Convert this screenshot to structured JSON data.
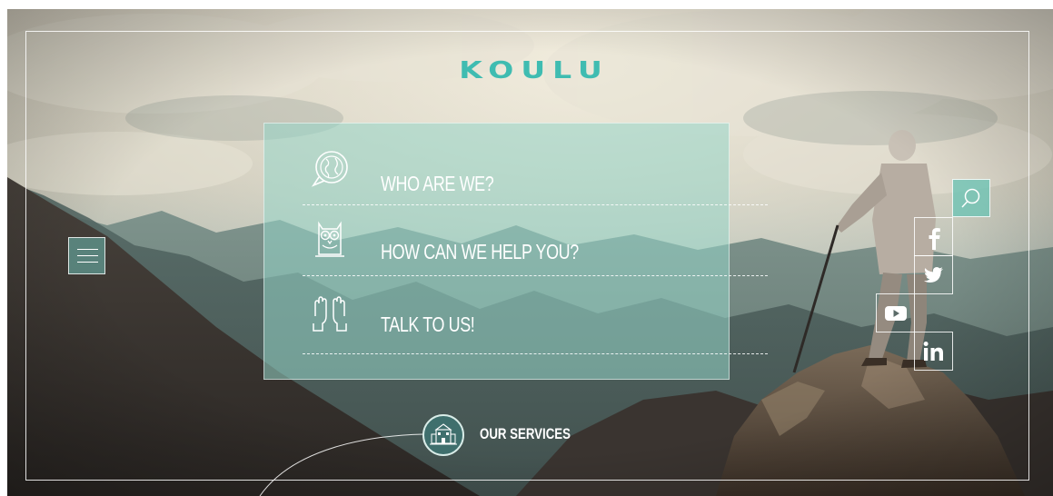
{
  "brand": {
    "logo_text": "KOULU",
    "accent_color": "#3fbcb1"
  },
  "nav_menu": {
    "items": [
      {
        "label": "WHO ARE WE?",
        "icon": "globe-chat-icon"
      },
      {
        "label": "HOW CAN WE HELP YOU?",
        "icon": "owl-icon"
      },
      {
        "label": "TALK TO US!",
        "icon": "raised-hands-icon"
      }
    ]
  },
  "hamburger": {
    "icon": "hamburger-menu-icon"
  },
  "search": {
    "icon": "search-icon"
  },
  "social": [
    {
      "name": "facebook",
      "icon": "facebook-icon"
    },
    {
      "name": "twitter",
      "icon": "twitter-icon"
    },
    {
      "name": "youtube",
      "icon": "youtube-icon"
    },
    {
      "name": "linkedin",
      "icon": "linkedin-icon"
    }
  ],
  "services": {
    "label": "OUR SERVICES",
    "icon": "school-building-icon"
  },
  "background": {
    "scene": "mountain-hiker-photo"
  }
}
